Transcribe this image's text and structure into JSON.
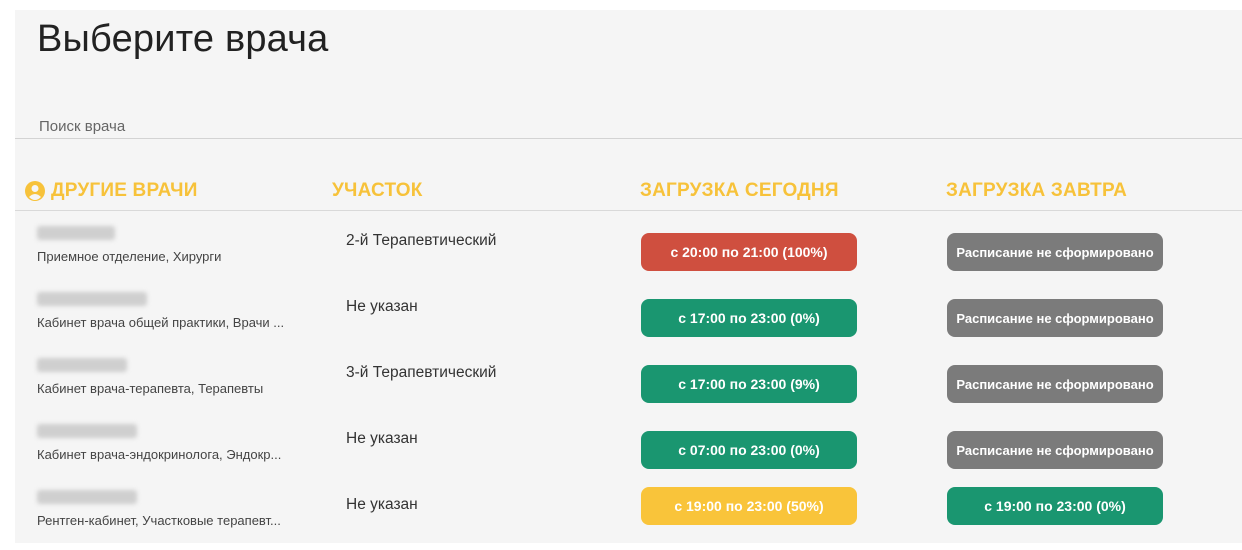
{
  "page": {
    "title": "Выберите врача"
  },
  "search": {
    "placeholder": "Поиск врача",
    "value": ""
  },
  "table": {
    "headers": {
      "doctors": "ДРУГИЕ ВРАЧИ",
      "district": "УЧАСТОК",
      "load_today": "ЗАГРУЗКА СЕГОДНЯ",
      "load_tomorrow": "ЗАГРУЗКА ЗАВТРА"
    },
    "header_icon": "user-circle-icon",
    "rows": [
      {
        "department": "Приемное отделение, Хирурги",
        "district": "2-й Терапевтический",
        "today": {
          "text": "с 20:00 по 21:00 (100%)",
          "status": "red"
        },
        "tomorrow": {
          "text": "Расписание не сформировано",
          "status": "gray"
        }
      },
      {
        "department": "Кабинет врача общей практики, Врачи ...",
        "district": "Не указан",
        "today": {
          "text": "с 17:00 по 23:00 (0%)",
          "status": "green"
        },
        "tomorrow": {
          "text": "Расписание не сформировано",
          "status": "gray"
        }
      },
      {
        "department": "Кабинет врача-терапевта, Терапевты",
        "district": "3-й Терапевтический",
        "today": {
          "text": "с 17:00 по 23:00 (9%)",
          "status": "green"
        },
        "tomorrow": {
          "text": "Расписание не сформировано",
          "status": "gray"
        }
      },
      {
        "department": "Кабинет врача-эндокринолога, Эндокр...",
        "district": "Не указан",
        "today": {
          "text": "с 07:00 по 23:00 (0%)",
          "status": "green"
        },
        "tomorrow": {
          "text": "Расписание не сформировано",
          "status": "gray"
        }
      },
      {
        "department": "Рентген-кабинет, Участковые терапевт...",
        "district": "Не указан",
        "today": {
          "text": "с 19:00 по 23:00 (50%)",
          "status": "yellow"
        },
        "tomorrow": {
          "text": "с 19:00 по 23:00 (0%)",
          "status": "green"
        }
      }
    ]
  },
  "colors": {
    "accent": "#f7c23a",
    "red": "#cf4f3f",
    "green": "#1a9670",
    "yellow": "#f9c43a",
    "gray": "#7b7b7b"
  }
}
